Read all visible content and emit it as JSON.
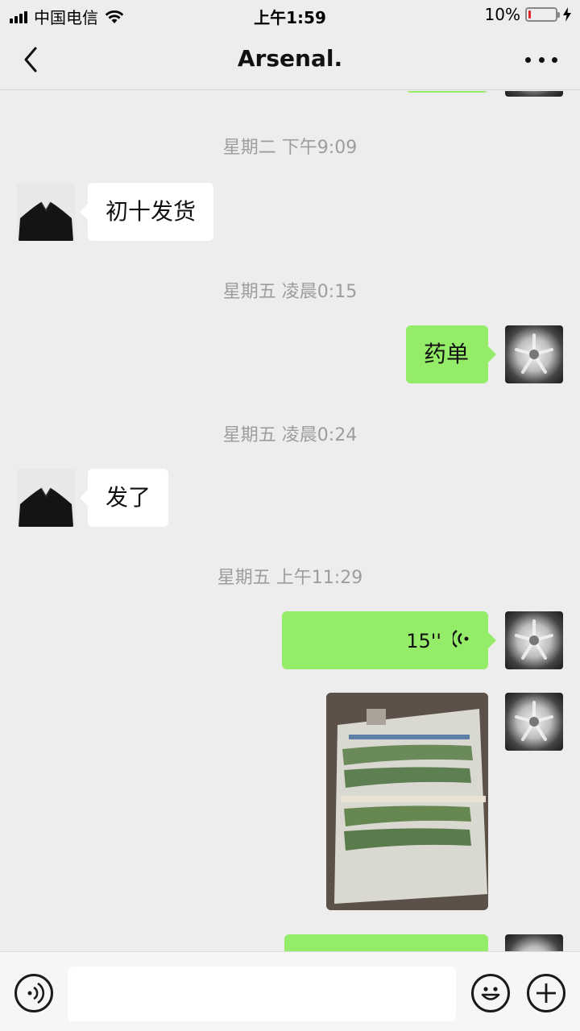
{
  "status_bar": {
    "carrier": "中国电信",
    "time": "上午1:59",
    "battery_percent": "10%",
    "battery_level": 0.1,
    "battery_color": "#e2252b"
  },
  "header": {
    "title": "Arsenal."
  },
  "messages": [
    {
      "type": "timestamp",
      "text": "星期二 下午9:09"
    },
    {
      "type": "text",
      "side": "left",
      "text": "初十发货"
    },
    {
      "type": "timestamp",
      "text": "星期五 凌晨0:15"
    },
    {
      "type": "text",
      "side": "right",
      "text": "药单"
    },
    {
      "type": "timestamp",
      "text": "星期五 凌晨0:24"
    },
    {
      "type": "text",
      "side": "left",
      "text": "发了"
    },
    {
      "type": "timestamp",
      "text": "星期五 上午11:29"
    },
    {
      "type": "voice",
      "side": "right",
      "duration": "15''"
    },
    {
      "type": "image",
      "side": "right"
    }
  ],
  "colors": {
    "background": "#ededed",
    "sent_bubble": "#95ec69",
    "received_bubble": "#ffffff",
    "timestamp_text": "#9d9d9d"
  },
  "icons": {
    "back": "chevron-left-icon",
    "more": "more-dots-icon",
    "voice_input": "voice-input-icon",
    "emoji": "emoji-icon",
    "add": "plus-circle-icon"
  }
}
